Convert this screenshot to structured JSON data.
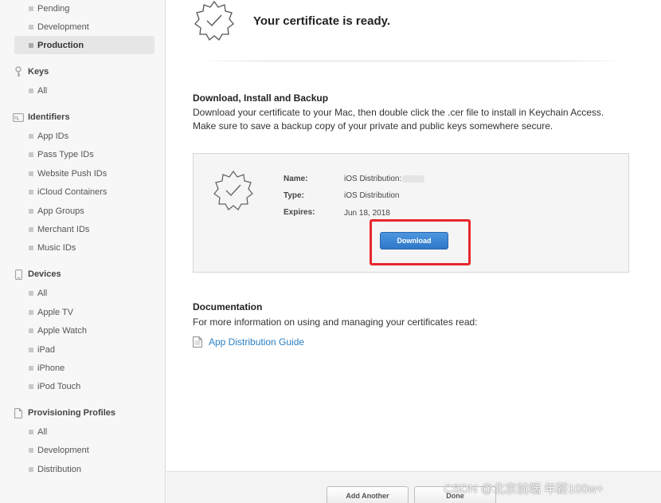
{
  "sidebar": {
    "certificates_items": [
      {
        "label": "Pending",
        "active": false
      },
      {
        "label": "Development",
        "active": false
      },
      {
        "label": "Production",
        "active": true
      }
    ],
    "keys": {
      "title": "Keys",
      "items": [
        "All"
      ]
    },
    "identifiers": {
      "title": "Identifiers",
      "items": [
        "App IDs",
        "Pass Type IDs",
        "Website Push IDs",
        "iCloud Containers",
        "App Groups",
        "Merchant IDs",
        "Music IDs"
      ]
    },
    "devices": {
      "title": "Devices",
      "items": [
        "All",
        "Apple TV",
        "Apple Watch",
        "iPad",
        "iPhone",
        "iPod Touch"
      ]
    },
    "profiles": {
      "title": "Provisioning Profiles",
      "items": [
        "All",
        "Development",
        "Distribution"
      ]
    }
  },
  "main": {
    "ready_title": "Your certificate is ready.",
    "download_heading": "Download, Install and Backup",
    "download_text": "Download your certificate to your Mac, then double click the .cer file to install in Keychain Access. Make sure to save a backup copy of your private and public keys somewhere secure.",
    "certificate": {
      "name_label": "Name:",
      "name_value": "iOS Distribution:",
      "type_label": "Type:",
      "type_value": "iOS Distribution",
      "expires_label": "Expires:",
      "expires_value": "Jun 18, 2018",
      "download_label": "Download"
    },
    "documentation_heading": "Documentation",
    "documentation_text": "For more information on using and managing your certificates read:",
    "guide_link": "App Distribution Guide"
  },
  "footer": {
    "add_another_label": "Add Another",
    "done_label": "Done"
  },
  "watermark": "CSDN @北京前端 年薪100w+",
  "colors": {
    "accent_link": "#2a7fc2",
    "button_blue": "#3a84d4",
    "highlight_red": "#e8262b"
  }
}
